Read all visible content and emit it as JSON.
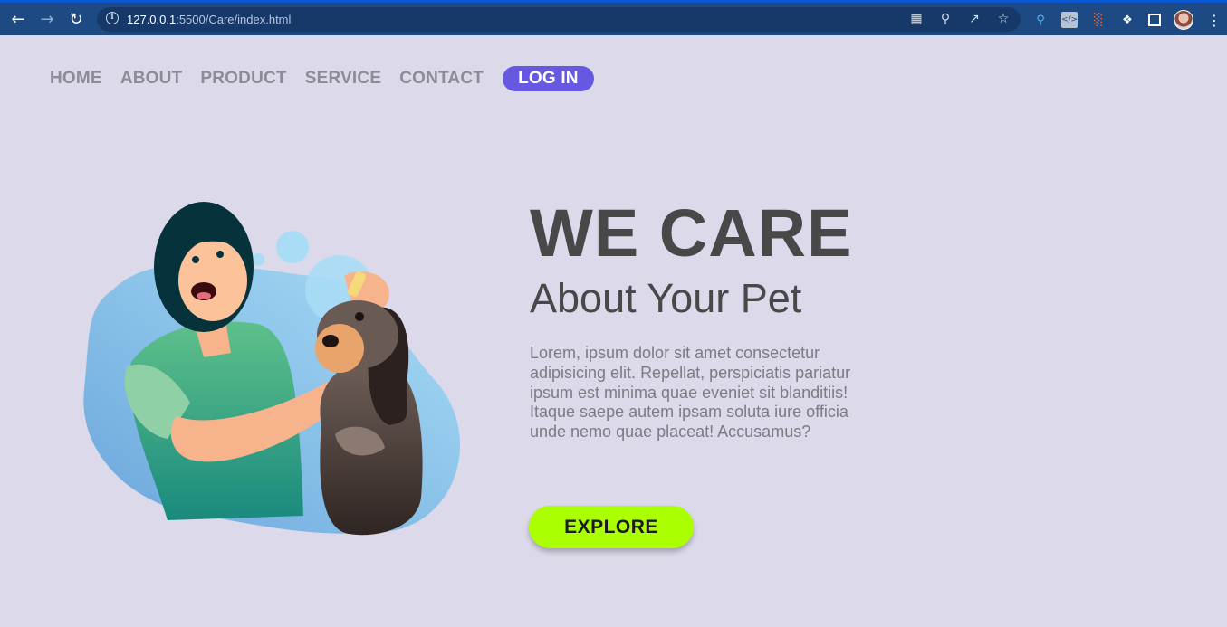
{
  "browser": {
    "url_host": "127.0.0.1",
    "url_rest": ":5500/Care/index.html"
  },
  "nav": {
    "items": [
      "HOME",
      "ABOUT",
      "PRODUCT",
      "SERVICE",
      "CONTACT"
    ],
    "login": "LOG IN"
  },
  "hero": {
    "title": "WE CARE",
    "subtitle": "About Your Pet",
    "description": "Lorem, ipsum dolor sit amet consectetur adipisicing elit. Repellat, perspiciatis pariatur ipsum est minima quae eveniet sit blanditiis! Itaque saepe autem ipsam soluta iure officia unde nemo quae placeat! Accusamus?",
    "cta": "EXPLORE"
  },
  "colors": {
    "page_bg": "#dcd9ea",
    "login_bg": "#6658e0",
    "cta_bg": "#aaff00",
    "heading": "#484848"
  }
}
